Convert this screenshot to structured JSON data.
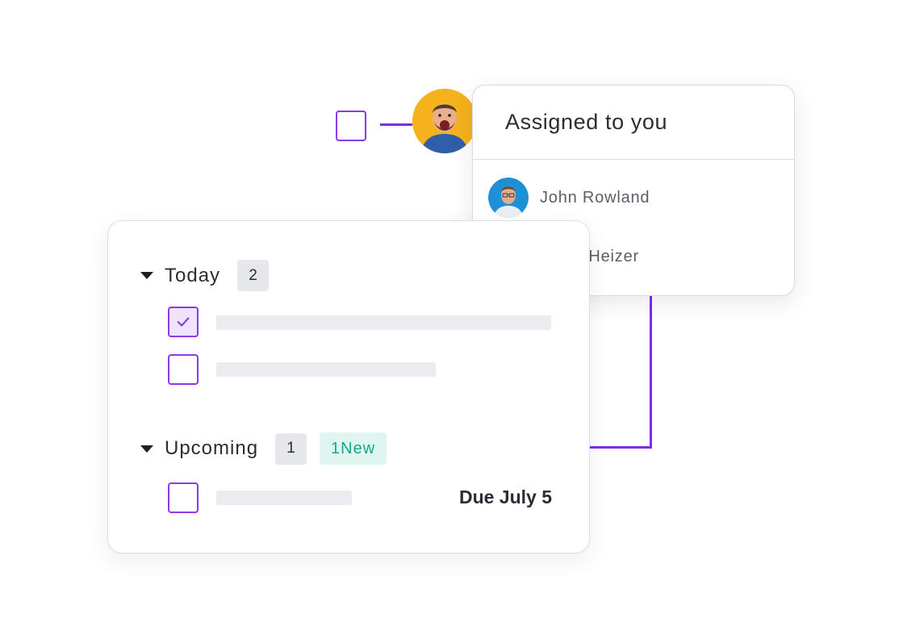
{
  "assignment": {
    "title": "Assigned to you",
    "people": [
      {
        "name": "John Rowland",
        "avatar_color": "#1e90d6"
      },
      {
        "name": "Kevin Heizer",
        "avatar_color": "#8a63e6"
      }
    ]
  },
  "tasks": {
    "sections": [
      {
        "title": "Today",
        "count": "2"
      },
      {
        "title": "Upcoming",
        "count": "1",
        "new_badge": "1New"
      }
    ],
    "due_label": "Due July 5"
  },
  "colors": {
    "accent": "#7b2ee6",
    "new_badge_text": "#14a889",
    "new_badge_bg": "#dff6f0",
    "assignee_avatar_bg": "#f6b21c"
  }
}
